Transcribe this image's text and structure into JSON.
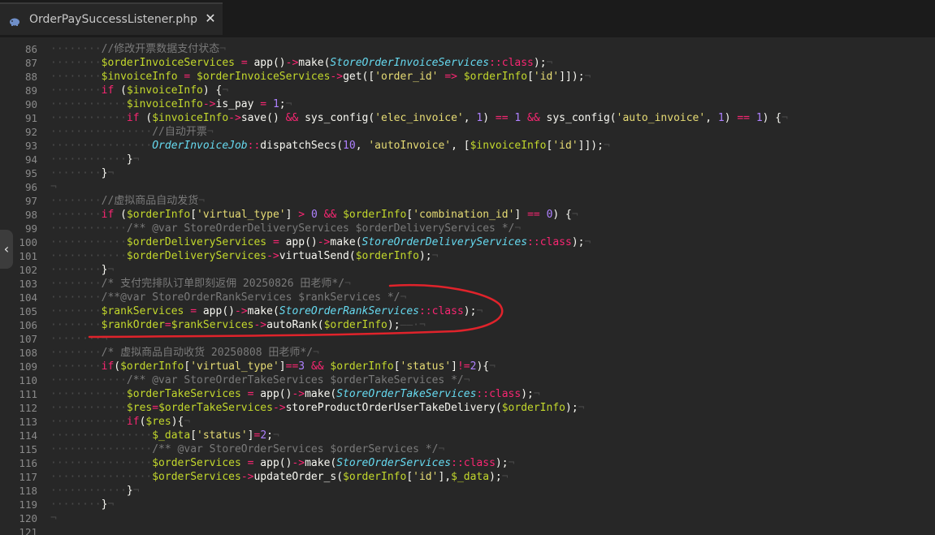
{
  "tab": {
    "title": "OrderPaySuccessListener.php",
    "close": "✕",
    "icon": "php-elephant-icon"
  },
  "side_toggle": "‹",
  "colors": {
    "annotation": "#e0232b",
    "background": "#272727"
  },
  "lines": [
    {
      "n": "86",
      "indent": 2,
      "tokens": [
        [
          "c",
          "//修改开票数据支付状态"
        ],
        [
          "ws",
          "¬"
        ]
      ]
    },
    {
      "n": "87",
      "indent": 2,
      "tokens": [
        [
          "v",
          "$orderInvoiceServices"
        ],
        [
          "p",
          " "
        ],
        [
          "k",
          "="
        ],
        [
          "p",
          " "
        ],
        [
          "f",
          "app()"
        ],
        [
          "k",
          "->"
        ],
        [
          "f",
          "make("
        ],
        [
          "cls",
          "StoreOrderInvoiceServices"
        ],
        [
          "k",
          "::"
        ],
        [
          "kw",
          "class"
        ],
        [
          "f",
          ");"
        ],
        [
          "ws",
          "¬"
        ]
      ]
    },
    {
      "n": "88",
      "indent": 2,
      "tokens": [
        [
          "v",
          "$invoiceInfo"
        ],
        [
          "p",
          " "
        ],
        [
          "k",
          "="
        ],
        [
          "p",
          " "
        ],
        [
          "v",
          "$orderInvoiceServices"
        ],
        [
          "k",
          "->"
        ],
        [
          "f",
          "get(["
        ],
        [
          "s",
          "'order_id'"
        ],
        [
          "p",
          " "
        ],
        [
          "k",
          "=>"
        ],
        [
          "p",
          " "
        ],
        [
          "v",
          "$orderInfo"
        ],
        [
          "f",
          "["
        ],
        [
          "s",
          "'id'"
        ],
        [
          "f",
          "]]);"
        ],
        [
          "ws",
          "¬"
        ]
      ]
    },
    {
      "n": "89",
      "indent": 2,
      "tokens": [
        [
          "kw",
          "if"
        ],
        [
          "p",
          " ("
        ],
        [
          "v",
          "$invoiceInfo"
        ],
        [
          "p",
          ") {"
        ],
        [
          "ws",
          "¬"
        ]
      ]
    },
    {
      "n": "90",
      "indent": 3,
      "tokens": [
        [
          "v",
          "$invoiceInfo"
        ],
        [
          "k",
          "->"
        ],
        [
          "f",
          "is_pay"
        ],
        [
          "p",
          " "
        ],
        [
          "k",
          "="
        ],
        [
          "p",
          " "
        ],
        [
          "n",
          "1"
        ],
        [
          "f",
          ";"
        ],
        [
          "ws",
          "¬"
        ]
      ]
    },
    {
      "n": "91",
      "indent": 3,
      "tokens": [
        [
          "kw",
          "if"
        ],
        [
          "p",
          " ("
        ],
        [
          "v",
          "$invoiceInfo"
        ],
        [
          "k",
          "->"
        ],
        [
          "f",
          "save()"
        ],
        [
          "p",
          " "
        ],
        [
          "k",
          "&&"
        ],
        [
          "p",
          " "
        ],
        [
          "f",
          "sys_config("
        ],
        [
          "s",
          "'elec_invoice'"
        ],
        [
          "f",
          ", "
        ],
        [
          "n",
          "1"
        ],
        [
          "f",
          ")"
        ],
        [
          "p",
          " "
        ],
        [
          "k",
          "=="
        ],
        [
          "p",
          " "
        ],
        [
          "n",
          "1"
        ],
        [
          "p",
          " "
        ],
        [
          "k",
          "&&"
        ],
        [
          "p",
          " "
        ],
        [
          "f",
          "sys_config("
        ],
        [
          "s",
          "'auto_invoice'"
        ],
        [
          "f",
          ", "
        ],
        [
          "n",
          "1"
        ],
        [
          "f",
          ")"
        ],
        [
          "p",
          " "
        ],
        [
          "k",
          "=="
        ],
        [
          "p",
          " "
        ],
        [
          "n",
          "1"
        ],
        [
          "f",
          ")"
        ],
        [
          "p",
          " {"
        ],
        [
          "ws",
          "¬"
        ]
      ]
    },
    {
      "n": "92",
      "indent": 4,
      "tokens": [
        [
          "c",
          "//自动开票"
        ],
        [
          "ws",
          "¬"
        ]
      ]
    },
    {
      "n": "93",
      "indent": 4,
      "tokens": [
        [
          "cls",
          "OrderInvoiceJob"
        ],
        [
          "k",
          "::"
        ],
        [
          "f",
          "dispatchSecs("
        ],
        [
          "n",
          "10"
        ],
        [
          "f",
          ", "
        ],
        [
          "s",
          "'autoInvoice'"
        ],
        [
          "f",
          ", ["
        ],
        [
          "v",
          "$invoiceInfo"
        ],
        [
          "f",
          "["
        ],
        [
          "s",
          "'id'"
        ],
        [
          "f",
          "]]);"
        ],
        [
          "ws",
          "¬"
        ]
      ]
    },
    {
      "n": "94",
      "indent": 3,
      "tokens": [
        [
          "p",
          "}"
        ],
        [
          "ws",
          "¬"
        ]
      ]
    },
    {
      "n": "95",
      "indent": 2,
      "tokens": [
        [
          "p",
          "}"
        ],
        [
          "ws",
          "¬"
        ]
      ]
    },
    {
      "n": "96",
      "indent": 0,
      "tokens": [
        [
          "ws",
          "¬"
        ]
      ]
    },
    {
      "n": "97",
      "indent": 2,
      "tokens": [
        [
          "c",
          "//虚拟商品自动发货"
        ],
        [
          "ws",
          "¬"
        ]
      ]
    },
    {
      "n": "98",
      "indent": 2,
      "tokens": [
        [
          "kw",
          "if"
        ],
        [
          "p",
          " ("
        ],
        [
          "v",
          "$orderInfo"
        ],
        [
          "f",
          "["
        ],
        [
          "s",
          "'virtual_type'"
        ],
        [
          "f",
          "]"
        ],
        [
          "p",
          " "
        ],
        [
          "k",
          ">"
        ],
        [
          "p",
          " "
        ],
        [
          "n",
          "0"
        ],
        [
          "p",
          " "
        ],
        [
          "k",
          "&&"
        ],
        [
          "p",
          " "
        ],
        [
          "v",
          "$orderInfo"
        ],
        [
          "f",
          "["
        ],
        [
          "s",
          "'combination_id'"
        ],
        [
          "f",
          "]"
        ],
        [
          "p",
          " "
        ],
        [
          "k",
          "=="
        ],
        [
          "p",
          " "
        ],
        [
          "n",
          "0"
        ],
        [
          "f",
          ")"
        ],
        [
          "p",
          " {"
        ],
        [
          "ws",
          "¬"
        ]
      ]
    },
    {
      "n": "99",
      "indent": 3,
      "tokens": [
        [
          "c",
          "/** @var StoreOrderDeliveryServices $orderDeliveryServices */"
        ],
        [
          "ws",
          "¬"
        ]
      ]
    },
    {
      "n": "100",
      "indent": 3,
      "tokens": [
        [
          "v",
          "$orderDeliveryServices"
        ],
        [
          "p",
          " "
        ],
        [
          "k",
          "="
        ],
        [
          "p",
          " "
        ],
        [
          "f",
          "app()"
        ],
        [
          "k",
          "->"
        ],
        [
          "f",
          "make("
        ],
        [
          "cls",
          "StoreOrderDeliveryServices"
        ],
        [
          "k",
          "::"
        ],
        [
          "kw",
          "class"
        ],
        [
          "f",
          ");"
        ],
        [
          "ws",
          "¬"
        ]
      ]
    },
    {
      "n": "101",
      "indent": 3,
      "tokens": [
        [
          "v",
          "$orderDeliveryServices"
        ],
        [
          "k",
          "->"
        ],
        [
          "f",
          "virtualSend("
        ],
        [
          "v",
          "$orderInfo"
        ],
        [
          "f",
          ");"
        ],
        [
          "ws",
          "¬"
        ]
      ]
    },
    {
      "n": "102",
      "indent": 2,
      "tokens": [
        [
          "p",
          "}"
        ],
        [
          "ws",
          "¬"
        ]
      ]
    },
    {
      "n": "103",
      "indent": 2,
      "tokens": [
        [
          "c",
          "/* 支付完排队订单即刻返佣 20250826 田老师*/"
        ],
        [
          "ws",
          "¬"
        ]
      ]
    },
    {
      "n": "104",
      "indent": 2,
      "tokens": [
        [
          "c",
          "/**@var StoreOrderRankServices $rankServices */"
        ],
        [
          "ws",
          "¬"
        ]
      ]
    },
    {
      "n": "105",
      "indent": 2,
      "tokens": [
        [
          "v",
          "$rankServices"
        ],
        [
          "p",
          " "
        ],
        [
          "k",
          "="
        ],
        [
          "p",
          " "
        ],
        [
          "f",
          "app()"
        ],
        [
          "k",
          "->"
        ],
        [
          "f",
          "make("
        ],
        [
          "cls",
          "StoreOrderRankServices"
        ],
        [
          "k",
          "::"
        ],
        [
          "kw",
          "class"
        ],
        [
          "f",
          ");"
        ],
        [
          "ws",
          "¬"
        ]
      ]
    },
    {
      "n": "106",
      "indent": 2,
      "tokens": [
        [
          "v",
          "$rankOrder"
        ],
        [
          "k",
          "="
        ],
        [
          "v",
          "$rankServices"
        ],
        [
          "k",
          "->"
        ],
        [
          "f",
          "autoRank("
        ],
        [
          "v",
          "$orderInfo"
        ],
        [
          "f",
          ");"
        ],
        [
          "ws",
          "——·¬"
        ]
      ]
    },
    {
      "n": "107",
      "indent": 2,
      "tokens": [
        [
          "ws",
          "¬"
        ]
      ]
    },
    {
      "n": "108",
      "indent": 2,
      "tokens": [
        [
          "c",
          "/* 虚拟商品自动收货 20250808 田老师*/"
        ],
        [
          "ws",
          "¬"
        ]
      ]
    },
    {
      "n": "109",
      "indent": 2,
      "tokens": [
        [
          "kw",
          "if"
        ],
        [
          "f",
          "("
        ],
        [
          "v",
          "$orderInfo"
        ],
        [
          "f",
          "["
        ],
        [
          "s",
          "'virtual_type'"
        ],
        [
          "f",
          "]"
        ],
        [
          "k",
          "=="
        ],
        [
          "n",
          "3"
        ],
        [
          "p",
          " "
        ],
        [
          "k",
          "&&"
        ],
        [
          "p",
          " "
        ],
        [
          "v",
          "$orderInfo"
        ],
        [
          "f",
          "["
        ],
        [
          "s",
          "'status'"
        ],
        [
          "f",
          "]"
        ],
        [
          "k",
          "!="
        ],
        [
          "n",
          "2"
        ],
        [
          "f",
          "){"
        ],
        [
          "ws",
          "¬"
        ]
      ]
    },
    {
      "n": "110",
      "indent": 3,
      "tokens": [
        [
          "c",
          "/** @var StoreOrderTakeServices $orderTakeServices */"
        ],
        [
          "ws",
          "¬"
        ]
      ]
    },
    {
      "n": "111",
      "indent": 3,
      "tokens": [
        [
          "v",
          "$orderTakeServices"
        ],
        [
          "p",
          " "
        ],
        [
          "k",
          "="
        ],
        [
          "p",
          " "
        ],
        [
          "f",
          "app()"
        ],
        [
          "k",
          "->"
        ],
        [
          "f",
          "make("
        ],
        [
          "cls",
          "StoreOrderTakeServices"
        ],
        [
          "k",
          "::"
        ],
        [
          "kw",
          "class"
        ],
        [
          "f",
          ");"
        ],
        [
          "ws",
          "¬"
        ]
      ]
    },
    {
      "n": "112",
      "indent": 3,
      "tokens": [
        [
          "v",
          "$res"
        ],
        [
          "k",
          "="
        ],
        [
          "v",
          "$orderTakeServices"
        ],
        [
          "k",
          "->"
        ],
        [
          "f",
          "storeProductOrderUserTakeDelivery("
        ],
        [
          "v",
          "$orderInfo"
        ],
        [
          "f",
          ");"
        ],
        [
          "ws",
          "¬"
        ]
      ]
    },
    {
      "n": "113",
      "indent": 3,
      "tokens": [
        [
          "kw",
          "if"
        ],
        [
          "f",
          "("
        ],
        [
          "v",
          "$res"
        ],
        [
          "f",
          "){"
        ],
        [
          "ws",
          "¬"
        ]
      ]
    },
    {
      "n": "114",
      "indent": 4,
      "tokens": [
        [
          "v",
          "$_data"
        ],
        [
          "f",
          "["
        ],
        [
          "s",
          "'status'"
        ],
        [
          "f",
          "]"
        ],
        [
          "k",
          "="
        ],
        [
          "n",
          "2"
        ],
        [
          "f",
          ";"
        ],
        [
          "ws",
          "¬"
        ]
      ]
    },
    {
      "n": "115",
      "indent": 4,
      "tokens": [
        [
          "c",
          "/** @var StoreOrderServices $orderServices */"
        ],
        [
          "ws",
          "¬"
        ]
      ]
    },
    {
      "n": "116",
      "indent": 4,
      "tokens": [
        [
          "v",
          "$orderServices"
        ],
        [
          "p",
          " "
        ],
        [
          "k",
          "="
        ],
        [
          "p",
          " "
        ],
        [
          "f",
          "app()"
        ],
        [
          "k",
          "->"
        ],
        [
          "f",
          "make("
        ],
        [
          "cls",
          "StoreOrderServices"
        ],
        [
          "k",
          "::"
        ],
        [
          "kw",
          "class"
        ],
        [
          "f",
          ");"
        ],
        [
          "ws",
          "¬"
        ]
      ]
    },
    {
      "n": "117",
      "indent": 4,
      "tokens": [
        [
          "v",
          "$orderServices"
        ],
        [
          "k",
          "->"
        ],
        [
          "f",
          "updateOrder_s("
        ],
        [
          "v",
          "$orderInfo"
        ],
        [
          "f",
          "["
        ],
        [
          "s",
          "'id'"
        ],
        [
          "f",
          "],"
        ],
        [
          "v",
          "$_data"
        ],
        [
          "f",
          ");"
        ],
        [
          "ws",
          "¬"
        ]
      ]
    },
    {
      "n": "118",
      "indent": 3,
      "tokens": [
        [
          "p",
          "}"
        ],
        [
          "ws",
          "¬"
        ]
      ]
    },
    {
      "n": "119",
      "indent": 2,
      "tokens": [
        [
          "p",
          "}"
        ],
        [
          "ws",
          "¬"
        ]
      ]
    },
    {
      "n": "120",
      "indent": 0,
      "tokens": [
        [
          "ws",
          "¬"
        ]
      ]
    },
    {
      "n": "121",
      "indent": 0,
      "tokens": []
    }
  ]
}
